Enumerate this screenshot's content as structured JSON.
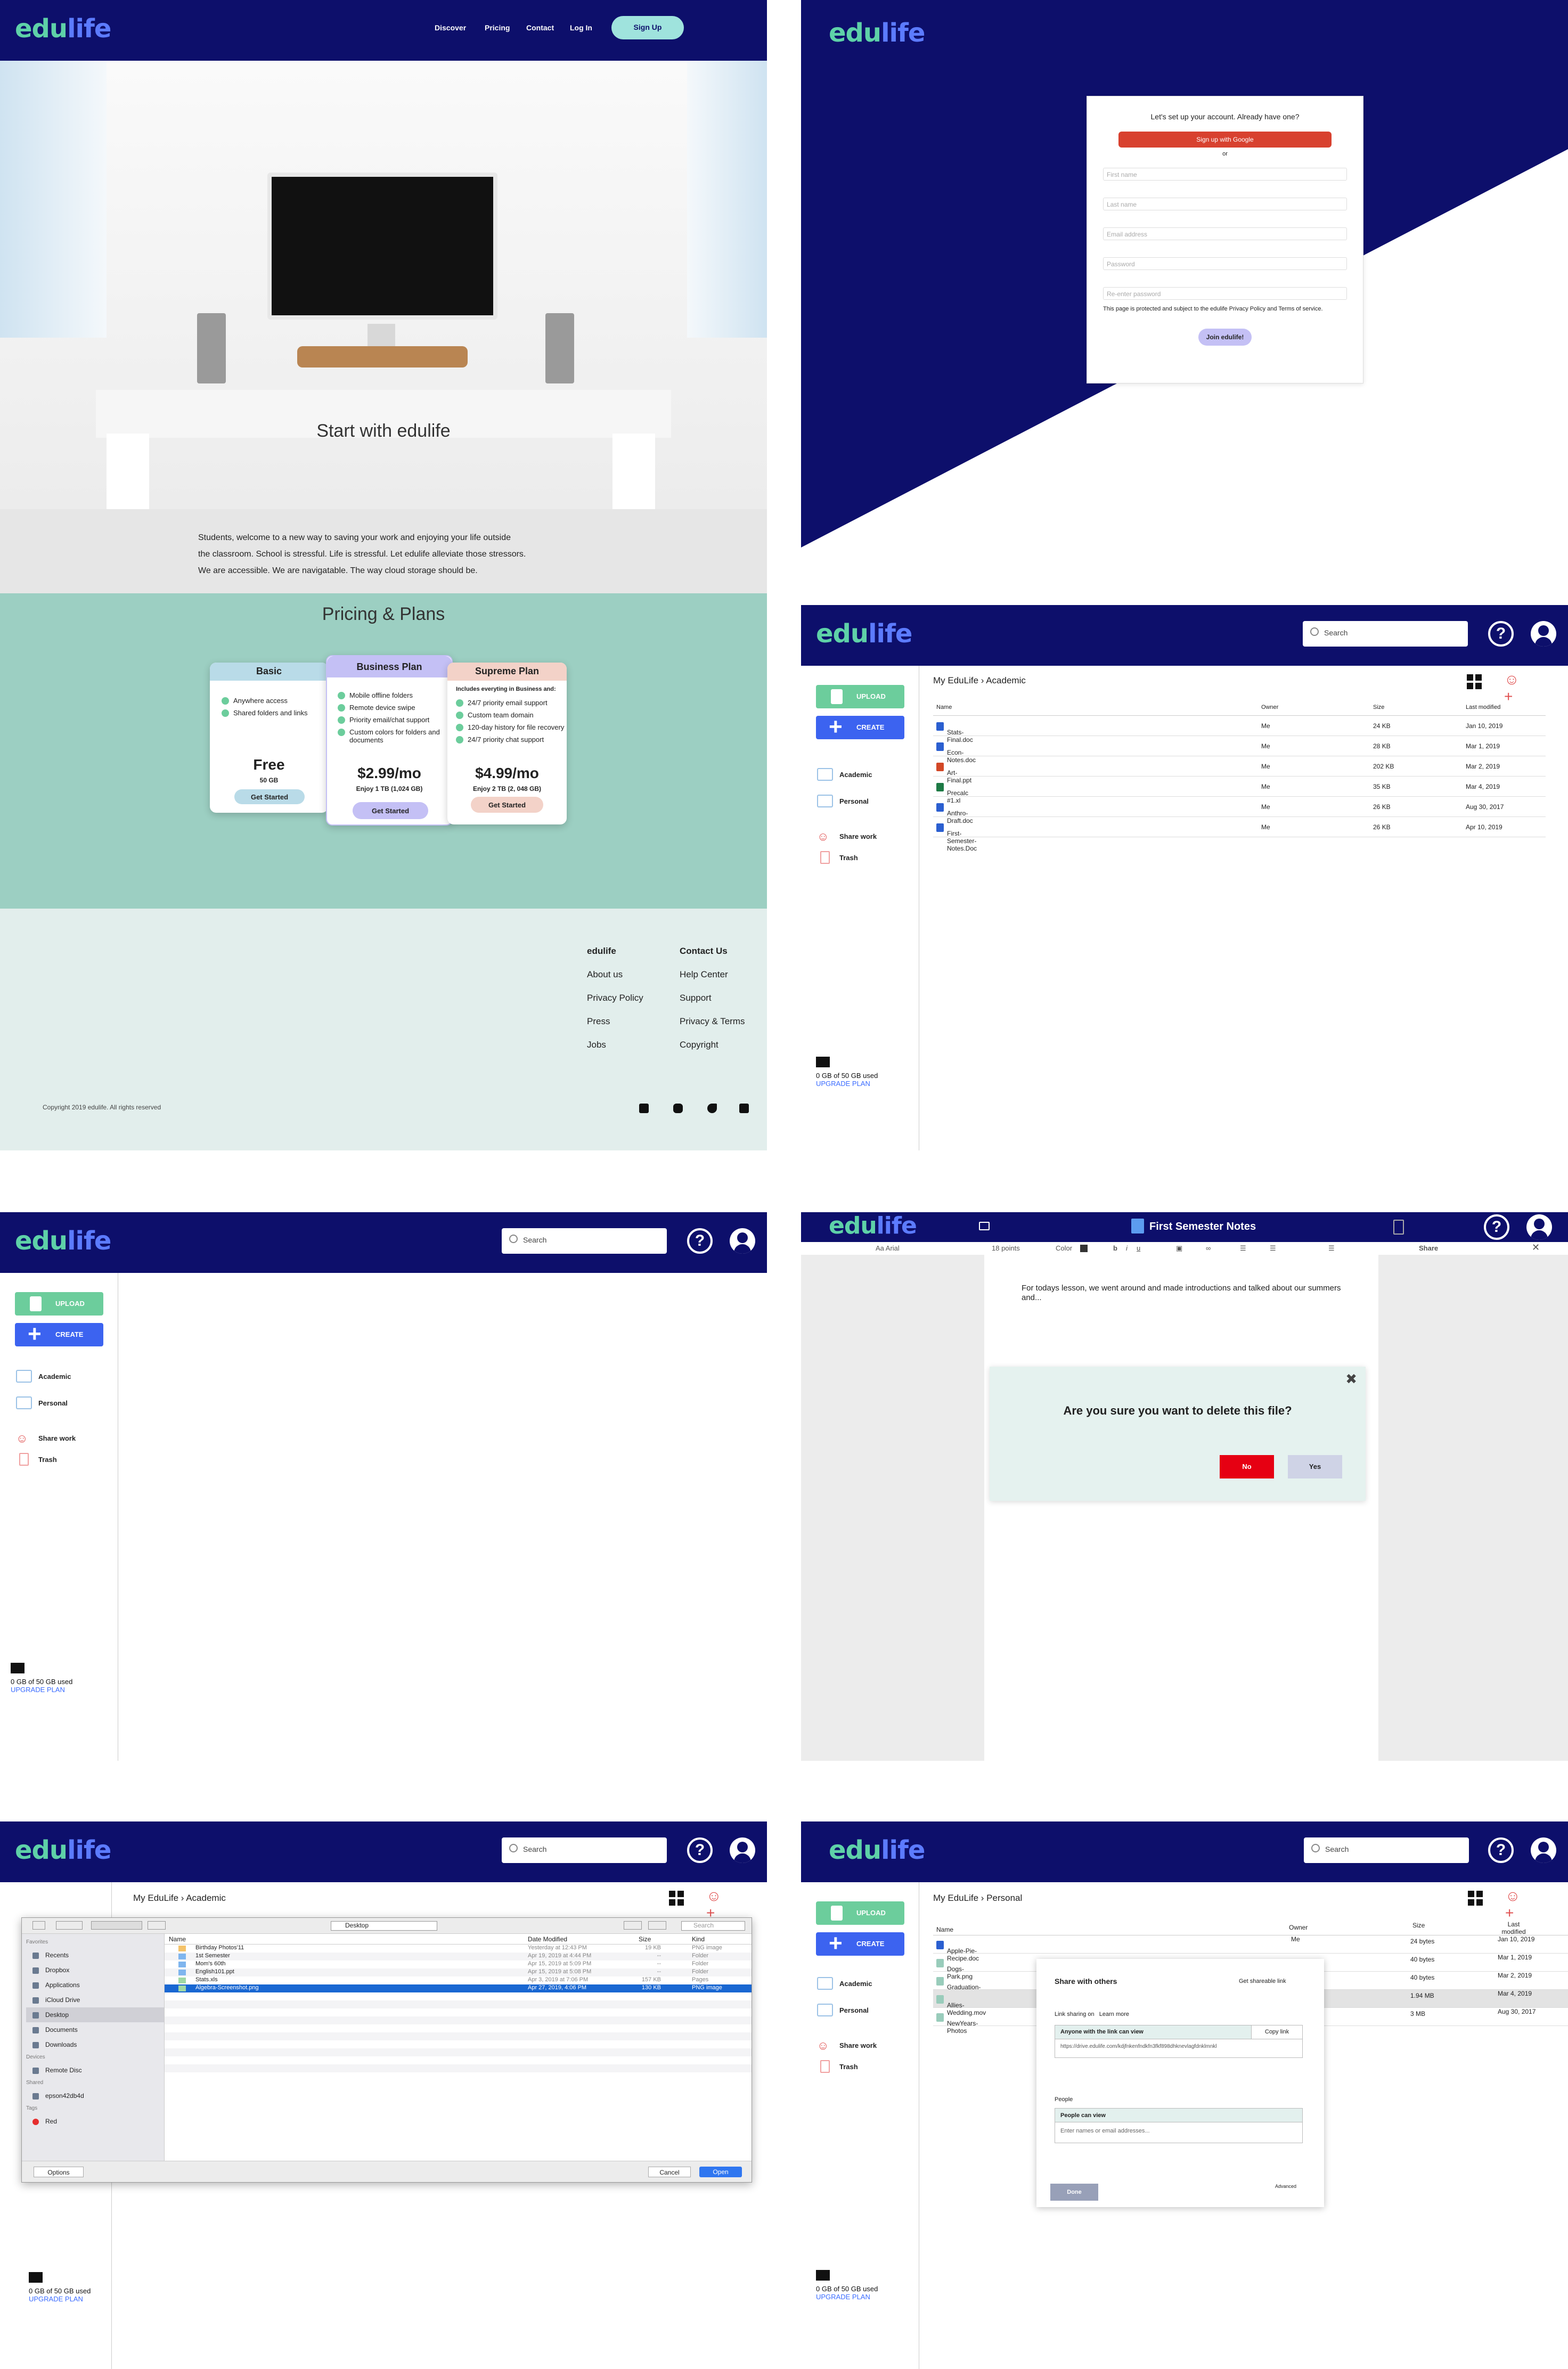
{
  "brand": {
    "logo_a": "edu",
    "logo_b": "life"
  },
  "landing": {
    "nav": [
      "Discover",
      "Pricing",
      "Contact",
      "Log In"
    ],
    "signup_label": "Sign Up",
    "hero_title": "Start with edulife",
    "intro": [
      "Students, welcome to a new way to saving your work and enjoying your life outside",
      "the classroom.   School is stressful. Life is stressful. Let edulife alleviate those stressors.",
      "We are accessible. We are navigatable. The way cloud storage should be."
    ],
    "pricing_title": "Pricing & Plans",
    "plans": [
      {
        "name": "Basic",
        "features": [
          "Anywhere access",
          "Shared folders and links"
        ],
        "price": "Free",
        "storage": "50 GB",
        "cta": "Get Started",
        "color": "#b9dbe8"
      },
      {
        "name": "Business Plan",
        "features": [
          "Mobile offline folders",
          "Remote device swipe",
          "Priority email/chat support",
          "Custom colors for folders and documents"
        ],
        "price": "$2.99/mo",
        "storage": "Enjoy 1 TB (1,024 GB)",
        "cta": "Get Started",
        "color": "#c4c0f5"
      },
      {
        "name": "Supreme Plan",
        "intro": "Includes everyting in Business and:",
        "features": [
          "24/7 priority email support",
          "Custom team domain",
          "120-day history for file recovery",
          "24/7 priority chat support"
        ],
        "price": "$4.99/mo",
        "storage": "Enjoy 2 TB (2, 048 GB)",
        "cta": "Get Started",
        "color": "#f3d2c8"
      }
    ],
    "footer": {
      "col1": [
        "edulife",
        "About us",
        "Privacy Policy",
        "Press",
        "Jobs"
      ],
      "col2": [
        "Contact Us",
        "Help Center",
        "Support",
        "Privacy & Terms",
        "Copyright"
      ],
      "copyright": "Copyright 2019 edulife. All rights reserved",
      "social_icons": [
        "linkedin-icon",
        "instagram-icon",
        "twitter-icon",
        "facebook-icon"
      ]
    }
  },
  "signup": {
    "prompt": "Let's set up your account. Already have one?",
    "google": "Sign up with Google",
    "or": "or",
    "fields": [
      "First name",
      "Last name",
      "Email address",
      "Password",
      "Re-enter password"
    ],
    "legal": "This page is protected and subject to the edulife Privacy Policy and Terms of service.",
    "join": "Join edulife!"
  },
  "app": {
    "search_placeholder": "Search",
    "upload": "UPLOAD",
    "create": "CREATE",
    "folders": [
      "Academic",
      "Personal"
    ],
    "share_work": "Share work",
    "trash": "Trash",
    "storage": "0 GB of 50 GB used",
    "upgrade": "UPGRADE PLAN"
  },
  "academic": {
    "breadcrumb": [
      "My EduLife",
      "Academic"
    ],
    "columns": [
      "Name",
      "Owner",
      "Size",
      "Last modified"
    ],
    "files": [
      {
        "icon": "w",
        "name": "Stats-Final.doc",
        "owner": "Me",
        "size": "24 KB",
        "date": "Jan 10, 2019"
      },
      {
        "icon": "w",
        "name": "Econ-Notes.doc",
        "owner": "Me",
        "size": "28 KB",
        "date": "Mar 1, 2019"
      },
      {
        "icon": "pp",
        "name": "Art-Final.ppt",
        "owner": "Me",
        "size": "202 KB",
        "date": "Mar 2, 2019"
      },
      {
        "icon": "x",
        "name": "Precalc #1.xl",
        "owner": "Me",
        "size": "35 KB",
        "date": "Mar 4, 2019"
      },
      {
        "icon": "w",
        "name": "Anthro-Draft.doc",
        "owner": "Me",
        "size": "26 KB",
        "date": "Aug 30, 2017"
      },
      {
        "icon": "w",
        "name": "First-Semester-Notes.Doc",
        "owner": "Me",
        "size": "26 KB",
        "date": "Apr 10, 2019"
      }
    ]
  },
  "editor": {
    "title": "First Semester Notes",
    "font": "Arial",
    "size": "18 points",
    "color": "Color",
    "share": "Share",
    "body": "For todays lesson, we went around and made introductions and talked about our summers and...",
    "dialog_q": "Are you sure you want to delete this file?",
    "no": "No",
    "yes": "Yes"
  },
  "finder": {
    "location": "Desktop",
    "search": "Search",
    "sidebar": {
      "favorites_label": "Favorites",
      "favorites": [
        "Recents",
        "Dropbox",
        "Applications",
        "iCloud Drive",
        "Desktop",
        "Documents",
        "Downloads"
      ],
      "devices_label": "Devices",
      "devices": [
        "Remote Disc"
      ],
      "shared_label": "Shared",
      "shared": [
        "epson42db4d"
      ],
      "tags_label": "Tags",
      "tags": [
        "Red"
      ]
    },
    "columns": [
      "Name",
      "Date Modified",
      "Size",
      "Kind"
    ],
    "rows": [
      {
        "name": "Birthday Photos'11",
        "date": "Yesterday at 12:43 PM",
        "size": "19 KB",
        "kind": "PNG image"
      },
      {
        "name": "1st Semester",
        "date": "Apr 19, 2019 at 4:44 PM",
        "size": "--",
        "kind": "Folder"
      },
      {
        "name": "Mom's 60th",
        "date": "Apr 15, 2019 at 5:09 PM",
        "size": "--",
        "kind": "Folder"
      },
      {
        "name": "English101.ppt",
        "date": "Apr 15, 2019 at 5:08 PM",
        "size": "--",
        "kind": "Folder"
      },
      {
        "name": "Stats.xls",
        "date": "Apr 3, 2019 at 7:06 PM",
        "size": "157 KB",
        "kind": "Pages"
      },
      {
        "name": "Algebra-Screenshot.png",
        "date": "Apr 27, 2019, 4:06 PM",
        "size": "130 KB",
        "kind": "PNG image"
      }
    ],
    "options": "Options",
    "cancel": "Cancel",
    "open": "Open"
  },
  "personal": {
    "breadcrumb": [
      "My EduLife",
      "Personal"
    ],
    "columns": [
      "Name",
      "Owner",
      "Size",
      "Last modified"
    ],
    "files": [
      {
        "name": "Apple-Pie-Recipe.doc",
        "owner": "Me",
        "size": "24 bytes",
        "date": "Jan 10, 2019"
      },
      {
        "name": "Dogs-Park.png",
        "owner": "",
        "size": "40 bytes",
        "date": "Mar 1, 2019"
      },
      {
        "name": "Graduation-Photo-1.p",
        "owner": "",
        "size": "40 bytes",
        "date": "Mar 2, 2019"
      },
      {
        "name": "Allies-Wedding.mov",
        "owner": "",
        "size": "1.94 MB",
        "date": "Mar 4, 2019"
      },
      {
        "name": "NewYears-Photos",
        "owner": "",
        "size": "3 MB",
        "date": "Aug 30, 2017"
      }
    ],
    "share": {
      "title": "Share with others",
      "get_link": "Get shareable link",
      "sharing_on": "Link sharing on",
      "learn": "Learn more",
      "perm": "Anyone with the link can view",
      "copy": "Copy link",
      "url": "https://drive.edulife.com/kdjfnkenfndkfn3fkf898dhknevlagfdnklmnkl",
      "people": "People",
      "people_perm": "People can view",
      "people_placeholder": "Enter names or email addresses...",
      "done": "Done",
      "advanced": "Advanced"
    }
  }
}
